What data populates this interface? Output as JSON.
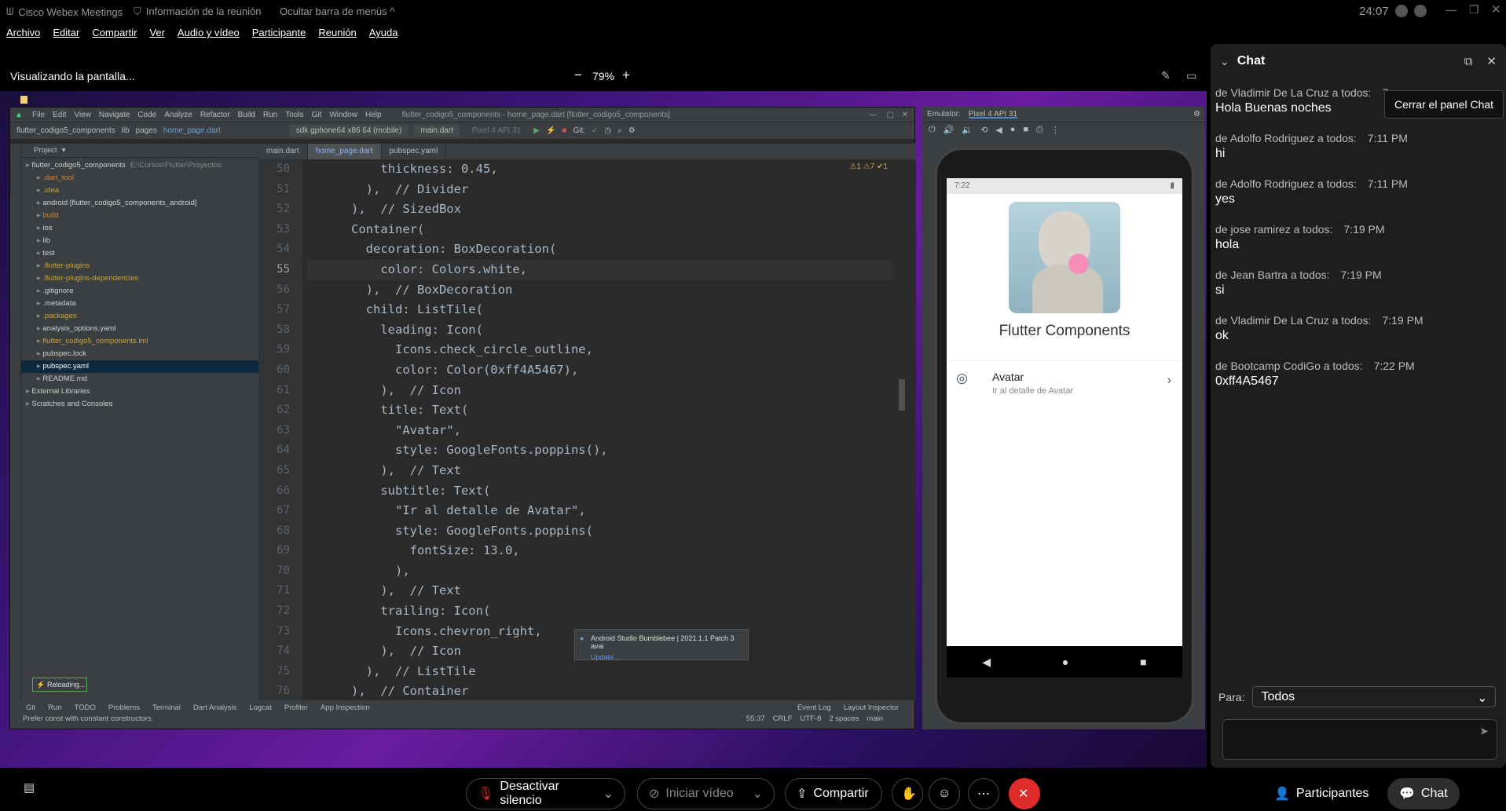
{
  "topbar": {
    "app_name": "Cisco Webex Meetings",
    "meeting_info": "Información de la reunión",
    "hide_menu": "Ocultar barra de menús",
    "time": "24:07"
  },
  "menu": [
    "Archivo",
    "Editar",
    "Compartir",
    "Ver",
    "Audio y vídeo",
    "Participante",
    "Reunión",
    "Ayuda"
  ],
  "share": {
    "label": "Visualizando la pantalla...",
    "zoom": "79%",
    "zoom_out": "−",
    "zoom_in": "+"
  },
  "ide": {
    "menu": [
      "File",
      "Edit",
      "View",
      "Navigate",
      "Code",
      "Analyze",
      "Refactor",
      "Build",
      "Run",
      "Tools",
      "Git",
      "Window",
      "Help"
    ],
    "window_title": "flutter_codigo5_components - home_page.dart [flutter_codigo5_components]",
    "breadcrumb": [
      "flutter_codigo5_components",
      "lib",
      "pages",
      "home_page.dart"
    ],
    "device_selector": "sdk gphone64 x86 64 (mobile)",
    "run_config": "main.dart",
    "avd": "Pixel 4 API 31",
    "project_label": "Project",
    "tree": [
      {
        "label": "flutter_codigo5_components",
        "extra": "E:\\Cursos\\Flutter\\Proyectos",
        "level": 0,
        "color": "#cfcfcf"
      },
      {
        "label": ".dart_tool",
        "level": 1,
        "color": "#d0873c"
      },
      {
        "label": ".idea",
        "level": 1,
        "color": "#c8a53f"
      },
      {
        "label": "android [flutter_codigo5_components_android]",
        "level": 1,
        "color": "#cfcfcf"
      },
      {
        "label": "build",
        "level": 1,
        "color": "#d0873c"
      },
      {
        "label": "ios",
        "level": 1,
        "color": "#cfcfcf"
      },
      {
        "label": "lib",
        "level": 1,
        "color": "#cfcfcf"
      },
      {
        "label": "test",
        "level": 1,
        "color": "#cfcfcf"
      },
      {
        "label": ".flutter-plugins",
        "level": 1,
        "color": "#c8a53f"
      },
      {
        "label": ".flutter-plugins-dependencies",
        "level": 1,
        "color": "#c8a53f"
      },
      {
        "label": ".gitignore",
        "level": 1,
        "color": "#cfcfcf"
      },
      {
        "label": ".metadata",
        "level": 1,
        "color": "#cfcfcf"
      },
      {
        "label": ".packages",
        "level": 1,
        "color": "#c8a53f"
      },
      {
        "label": "analysis_options.yaml",
        "level": 1,
        "color": "#cfcfcf"
      },
      {
        "label": "flutter_codigo5_components.iml",
        "level": 1,
        "color": "#c8a53f"
      },
      {
        "label": "pubspec.lock",
        "level": 1,
        "color": "#cfcfcf"
      },
      {
        "label": "pubspec.yaml",
        "level": 1,
        "color": "#ffffff"
      },
      {
        "label": "README.md",
        "level": 1,
        "color": "#cfcfcf"
      },
      {
        "label": "External Libraries",
        "level": 0,
        "color": "#cfcfcf"
      },
      {
        "label": "Scratches and Consoles",
        "level": 0,
        "color": "#cfcfcf"
      }
    ],
    "tabs": [
      "main.dart",
      "home_page.dart",
      "pubspec.yaml"
    ],
    "inspections": "⚠1 ⚠7 ✔1",
    "code_lines": [
      {
        "n": "50",
        "t": "          thickness: 0.45,"
      },
      {
        "n": "51",
        "t": "        ),  // Divider"
      },
      {
        "n": "52",
        "t": "      ),  // SizedBox"
      },
      {
        "n": "53",
        "t": "      Container("
      },
      {
        "n": "54",
        "t": "        decoration: BoxDecoration("
      },
      {
        "n": "55",
        "t": "          color: Colors.white,"
      },
      {
        "n": "56",
        "t": "        ),  // BoxDecoration"
      },
      {
        "n": "57",
        "t": "        child: ListTile("
      },
      {
        "n": "58",
        "t": "          leading: Icon("
      },
      {
        "n": "59",
        "t": "            Icons.check_circle_outline,"
      },
      {
        "n": "60",
        "t": "            color: Color(0xff4A5467),"
      },
      {
        "n": "61",
        "t": "          ),  // Icon"
      },
      {
        "n": "62",
        "t": "          title: Text("
      },
      {
        "n": "63",
        "t": "            \"Avatar\","
      },
      {
        "n": "64",
        "t": "            style: GoogleFonts.poppins(),"
      },
      {
        "n": "65",
        "t": "          ),  // Text"
      },
      {
        "n": "66",
        "t": "          subtitle: Text("
      },
      {
        "n": "67",
        "t": "            \"Ir al detalle de Avatar\","
      },
      {
        "n": "68",
        "t": "            style: GoogleFonts.poppins("
      },
      {
        "n": "69",
        "t": "              fontSize: 13.0,"
      },
      {
        "n": "70",
        "t": "            ),"
      },
      {
        "n": "71",
        "t": "          ),  // Text"
      },
      {
        "n": "72",
        "t": "          trailing: Icon("
      },
      {
        "n": "73",
        "t": "            Icons.chevron_right,"
      },
      {
        "n": "74",
        "t": "          ),  // Icon"
      },
      {
        "n": "75",
        "t": "        ),  // ListTile"
      },
      {
        "n": "76",
        "t": "      ),  // Container"
      }
    ],
    "notification": {
      "title": "Android Studio Bumblebee | 2021.1.1 Patch 3 avai",
      "link": "Update..."
    },
    "reloading": "Reloading...",
    "bottom_tabs": [
      "Git",
      "Run",
      "TODO",
      "Problems",
      "Terminal",
      "Dart Analysis",
      "Logcat",
      "Profiler",
      "App Inspection",
      "Event Log",
      "Layout Inspector"
    ],
    "status_hint": "Prefer const with constant constructors.",
    "status_right": [
      "55:37",
      "CRLF",
      "UTF-8",
      "2 spaces",
      "main"
    ]
  },
  "emulator": {
    "tab_label": "Emulator:",
    "device": "Pixel 4 API 31",
    "status_time": "7:22",
    "app_title": "Flutter Components",
    "tile_title": "Avatar",
    "tile_subtitle": "Ir al detalle de Avatar"
  },
  "chat": {
    "title": "Chat",
    "tooltip": "Cerrar el panel Chat",
    "messages": [
      {
        "from": "de Vladimir De La Cruz a todos:",
        "time": "7",
        "text": "Hola Buenas noches"
      },
      {
        "from": "de Adolfo Rodriguez a todos:",
        "time": "7:11 PM",
        "text": "hi"
      },
      {
        "from": "de Adolfo Rodriguez a todos:",
        "time": "7:11 PM",
        "text": "yes"
      },
      {
        "from": "de jose ramirez a todos:",
        "time": "7:19 PM",
        "text": "hola"
      },
      {
        "from": "de Jean Bartra a todos:",
        "time": "7:19 PM",
        "text": "si"
      },
      {
        "from": "de Vladimir De La Cruz a todos:",
        "time": "7:19 PM",
        "text": "ok"
      },
      {
        "from": "de Bootcamp CodiGo a todos:",
        "time": "7:22 PM",
        "text": "0xff4A5467"
      }
    ],
    "to_label": "Para:",
    "to_value": "Todos"
  },
  "controls": {
    "mute": "Desactivar silencio",
    "video": "Iniciar vídeo",
    "share": "Compartir",
    "participants": "Participantes",
    "chat": "Chat"
  },
  "colors": {
    "accent_red": "#e02b2b",
    "ide_bg": "#2b2b2b",
    "chat_bg": "#1e1e1e"
  }
}
